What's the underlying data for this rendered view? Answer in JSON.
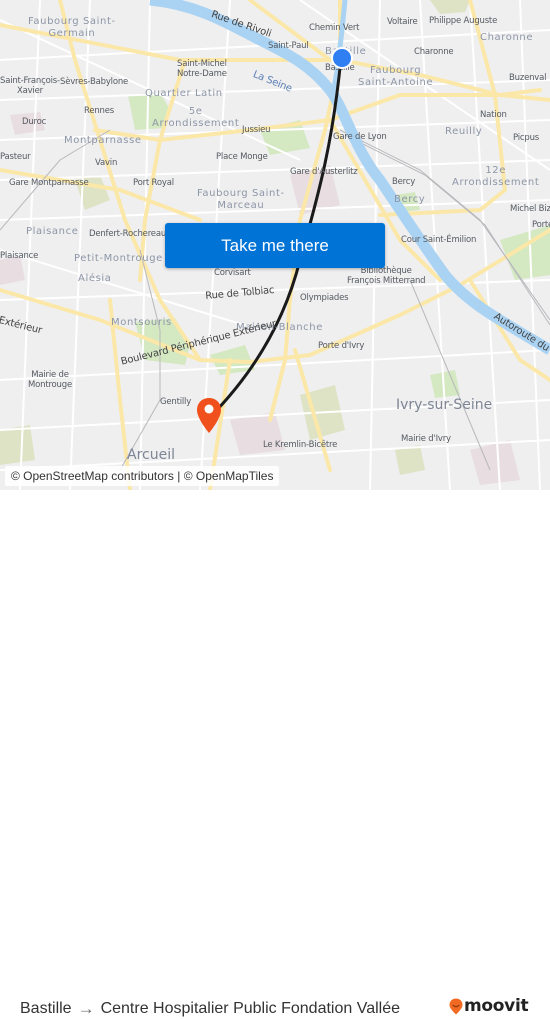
{
  "map": {
    "labels": {
      "faubourg_saint_germain": "Faubourg Saint-\nGermain",
      "rue_de_rivoli": "Rue de Rivoli",
      "chemin_vert": "Chemin Vert",
      "voltaire": "Voltaire",
      "philippe_auguste": "Philippe Auguste",
      "charonne_district": "Charonne",
      "saint_paul": "Saint-Paul",
      "bastille_district": "Bastille",
      "bastille_station": "Bastille",
      "charonne_station": "Charonne",
      "saint_francois_xavier": "Saint-François-\nXavier",
      "sevres_babylone": "Sèvres-Babylone",
      "saint_michel": "Saint-Michel\nNotre-Dame",
      "la_seine": "La Seine",
      "faubourg_saint_antoine": "Faubourg\nSaint-Antoine",
      "buzenval": "Buzenval",
      "quartier_latin": "Quartier Latin",
      "rennes": "Rennes",
      "fifth_arr": "5e\nArrondissement",
      "nation": "Nation",
      "duroc": "Duroc",
      "jussieu": "Jussieu",
      "montparnasse": "Montparnasse",
      "reuilly": "Reuilly",
      "picpus": "Picpus",
      "gare_de_lyon": "Gare de Lyon",
      "pasteur": "Pasteur",
      "vavin": "Vavin",
      "place_monge": "Place Monge",
      "twelfth_arr": "12e\nArrondissement",
      "gare_austerlitz": "Gare d'Austerlitz",
      "gare_montparnasse": "Gare Montparnasse",
      "port_royal": "Port Royal",
      "faubourg_saint_marceau": "Faubourg Saint-\nMarceau",
      "bercy_station": "Bercy",
      "bercy_district": "Bercy",
      "michel_bizot": "Michel Bizot",
      "porte_doree": "Porte",
      "plaisance_district": "Plaisance",
      "denfert": "Denfert-Rochereau",
      "cour_saint_emilion": "Cour Saint-Émilion",
      "plaisance_station": "Plaisance",
      "petit_montrouge": "Petit-Montrouge",
      "corvisart": "Corvisart",
      "bibliotheque": "Bibliothèque\nFrançois Mitterrand",
      "alesia": "Alésia",
      "rue_de_tolbiac": "Rue de Tolbiac",
      "olympiades": "Olympiades",
      "exterieur": "Extérieur",
      "montsouris": "Montsouris",
      "maison_blanche": "Maison-Blanche",
      "autoroute": "Autoroute du",
      "porte_divry": "Porte d'Ivry",
      "mairie_montrouge": "Mairie de\nMontrouge",
      "boulevard_peripherique": "Boulevard Périphérique Extérieur",
      "ivry": "Ivry-sur-Seine",
      "gentilly": "Gentilly",
      "mairie_divry": "Mairie d'Ivry",
      "kremlin": "Le Kremlin-Bicêtre",
      "arcueil": "Arcueil"
    },
    "colors": {
      "origin_marker": "#2f7ff2",
      "destination_marker": "#f0511c",
      "route_line": "#1a1a1a",
      "water": "#aad3f3",
      "park": "#cfe6b8",
      "major_road": "#fce9a6"
    }
  },
  "cta": {
    "label": "Take me there",
    "color": "#0073d6"
  },
  "attribution": "© OpenStreetMap contributors | © OpenMapTiles",
  "footer": {
    "origin": "Bastille",
    "arrow_icon": "→",
    "destination": "Centre Hospitalier Public Fondation Vallée",
    "brand": "moovit",
    "brand_color": "#f26a21"
  }
}
